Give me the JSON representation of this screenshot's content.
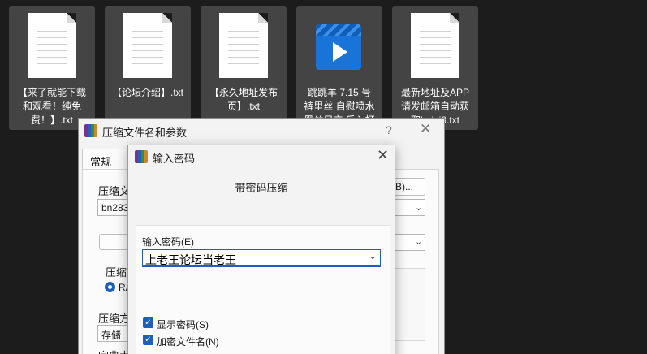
{
  "files": [
    {
      "name": "【来了就能下载\n和观看！纯免\n费！】.txt",
      "icon": "text-file-icon"
    },
    {
      "name": "【论坛介绍】.txt",
      "icon": "text-file-icon"
    },
    {
      "name": "【永久地址发布\n页】.txt",
      "icon": "text-file-icon"
    },
    {
      "name": "跳跳羊 7.15 号\n裤里丝 自慰喷水\n黑丝足交 后入打",
      "icon": "video-file-icon"
    },
    {
      "name": "最新地址及APP\n请发邮箱自动获\n取heiai8.txt",
      "icon": "text-file-icon"
    }
  ],
  "back_dialog": {
    "title": "压缩文件名和参数",
    "help": "?",
    "close": "✕",
    "tab": "常规",
    "archive_label": "压缩文",
    "archive_value": "bn283",
    "browse_button": "(B)...",
    "format_group_label": "压缩文",
    "rar_option": "RA",
    "method_label": "压缩方",
    "method_value": "存储",
    "dict_label": "字典大"
  },
  "front_dialog": {
    "title": "输入密码",
    "close": "✕",
    "heading": "带密码压缩",
    "password_label": "输入密码(E)",
    "password_value": "上老王论坛当老王",
    "show_password_label": "显示密码(S)",
    "encrypt_names_label": "加密文件名(N)",
    "show_password_checked": true,
    "encrypt_names_checked": true
  }
}
